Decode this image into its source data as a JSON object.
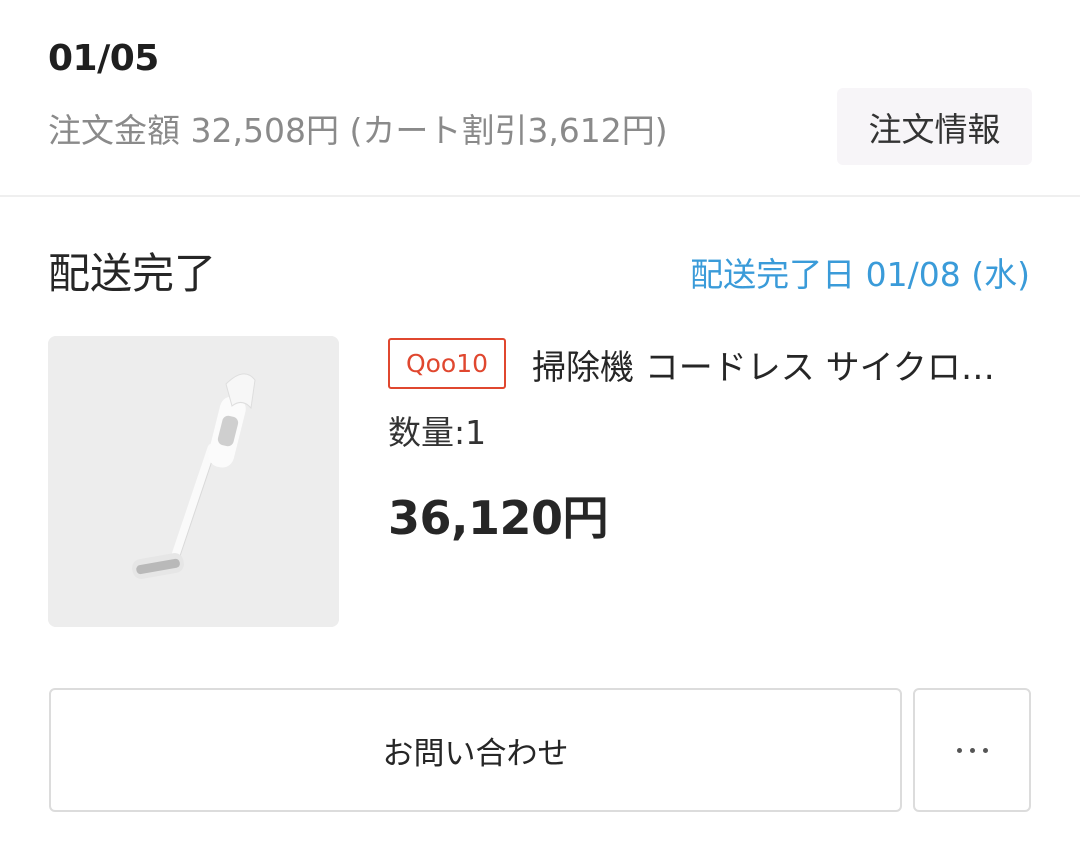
{
  "order": {
    "date": "01/05",
    "amount_text": "注文金額 32,508円 (カート割引3,612円)",
    "info_button_label": "注文情報"
  },
  "shipment": {
    "status": "配送完了",
    "delivery_date_text": "配送完了日 01/08 (水)"
  },
  "item": {
    "image_icon": "cordless-vacuum-product-image",
    "shop_badge": "Qoo10",
    "name": "掃除機 コードレス サイクロ…",
    "quantity_text": "数量:1",
    "price": "36,120円"
  },
  "actions": {
    "contact_label": "お問い合わせ",
    "more_icon": "more-dots-icon"
  },
  "colors": {
    "accent_blue": "#3a9bd9",
    "badge_red": "#e0472f"
  }
}
